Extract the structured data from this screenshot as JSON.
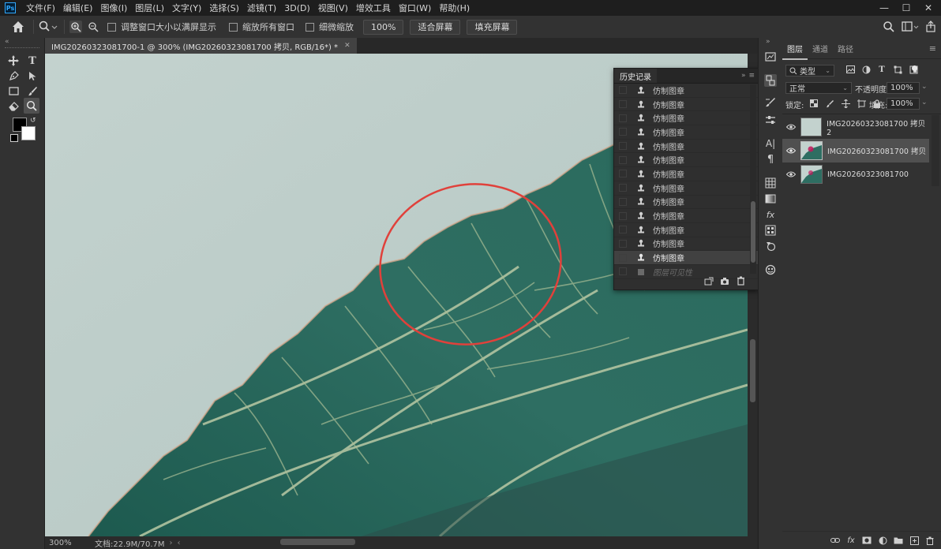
{
  "menubar": {
    "logo": "Ps",
    "items": [
      "文件(F)",
      "编辑(E)",
      "图像(I)",
      "图层(L)",
      "文字(Y)",
      "选择(S)",
      "滤镜(T)",
      "3D(D)",
      "视图(V)",
      "增效工具",
      "窗口(W)",
      "帮助(H)"
    ],
    "minimize": "—",
    "maximize": "☐",
    "close": "✕"
  },
  "options": {
    "resize_windows": "调整窗口大小以满屏显示",
    "zoom_all": "缩放所有窗口",
    "scrubby_zoom": "细微缩放",
    "zoom_value": "100%",
    "fit_screen": "适合屏幕",
    "fill_screen": "填充屏幕"
  },
  "document": {
    "tab_title": "IMG20260323081700-1 @ 300% (IMG20260323081700 拷贝, RGB/16*) *",
    "tab_close": "✕",
    "zoom": "300%",
    "doc_size": "文档:22.9M/70.7M"
  },
  "history": {
    "title": "历史记录",
    "items": [
      "仿制图章",
      "仿制图章",
      "仿制图章",
      "仿制图章",
      "仿制图章",
      "仿制图章",
      "仿制图章",
      "仿制图章",
      "仿制图章",
      "仿制图章",
      "仿制图章",
      "仿制图章",
      "仿制图章"
    ],
    "active_index": 12,
    "last_item": "图层可见性"
  },
  "layers_panel": {
    "tabs": [
      "图层",
      "通道",
      "路径"
    ],
    "filter_kind": "类型",
    "blend_mode": "正常",
    "opacity_label": "不透明度:",
    "opacity_value": "100%",
    "lock_label": "锁定:",
    "fill_label": "填充:",
    "fill_value": "100%",
    "layers": [
      {
        "name": "IMG20260323081700 拷贝 2",
        "selected": false
      },
      {
        "name": "IMG20260323081700 拷贝",
        "selected": true
      },
      {
        "name": "IMG20260323081700",
        "selected": false
      }
    ]
  },
  "colors": {
    "accent": "#31a8ff",
    "foreground": "#000000",
    "background": "#ffffff",
    "annotation_circle": "#e0413b",
    "leaf": "#2f6e62",
    "sky": "#c0cfcb"
  }
}
